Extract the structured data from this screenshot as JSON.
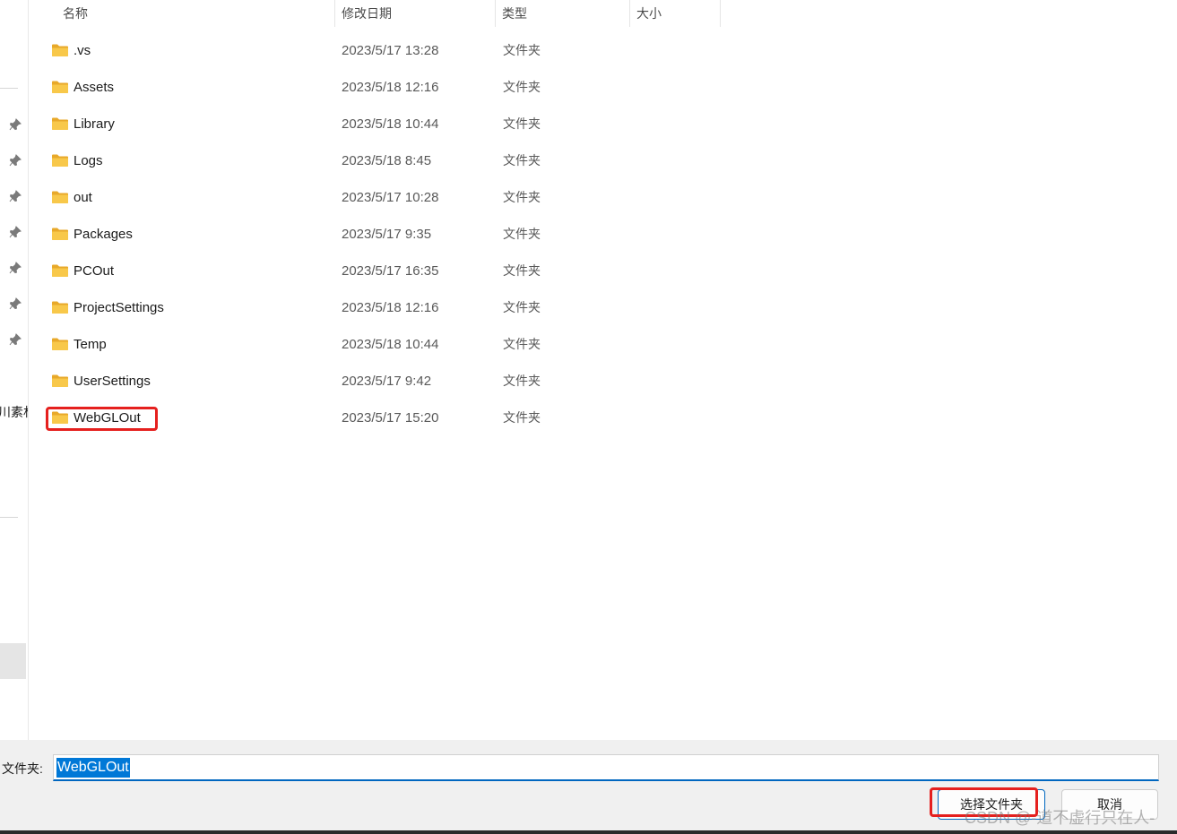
{
  "columns": {
    "name": "名称",
    "modified": "修改日期",
    "type": "类型",
    "size": "大小"
  },
  "nav": {
    "cut_label": "川素材"
  },
  "files": [
    {
      "name": ".vs",
      "modified": "2023/5/17 13:28",
      "type": "文件夹",
      "icon": "folder-icon"
    },
    {
      "name": "Assets",
      "modified": "2023/5/18 12:16",
      "type": "文件夹",
      "icon": "folder-icon"
    },
    {
      "name": "Library",
      "modified": "2023/5/18 10:44",
      "type": "文件夹",
      "icon": "folder-icon"
    },
    {
      "name": "Logs",
      "modified": "2023/5/18 8:45",
      "type": "文件夹",
      "icon": "folder-icon"
    },
    {
      "name": "out",
      "modified": "2023/5/17 10:28",
      "type": "文件夹",
      "icon": "folder-icon"
    },
    {
      "name": "Packages",
      "modified": "2023/5/17 9:35",
      "type": "文件夹",
      "icon": "folder-icon"
    },
    {
      "name": "PCOut",
      "modified": "2023/5/17 16:35",
      "type": "文件夹",
      "icon": "folder-icon"
    },
    {
      "name": "ProjectSettings",
      "modified": "2023/5/18 12:16",
      "type": "文件夹",
      "icon": "folder-icon"
    },
    {
      "name": "Temp",
      "modified": "2023/5/18 10:44",
      "type": "文件夹",
      "icon": "folder-icon"
    },
    {
      "name": "UserSettings",
      "modified": "2023/5/17 9:42",
      "type": "文件夹",
      "icon": "folder-icon"
    },
    {
      "name": "WebGLOut",
      "modified": "2023/5/17 15:20",
      "type": "文件夹",
      "icon": "folder-icon"
    }
  ],
  "footer": {
    "folder_label": "文件夹:",
    "folder_value": "WebGLOut",
    "select_button": "选择文件夹",
    "cancel_button": "取消"
  },
  "watermark": "CSDN @-道不虚行只在人-",
  "colors": {
    "accent": "#0078d7",
    "highlight": "#e5201e",
    "folder": "#f8c84a"
  }
}
